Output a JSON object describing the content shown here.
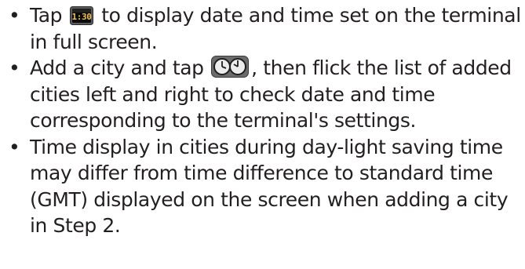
{
  "items": [
    {
      "bullet": "•",
      "before": "Tap ",
      "icon": "clock-display-icon",
      "after": " to display date and time set on the terminal in full screen."
    },
    {
      "bullet": "•",
      "before": "Add a city and tap ",
      "icon": "dual-clock-icon",
      "after": ", then flick the list of added cities left and right to check date and time corresponding to the terminal's settings."
    },
    {
      "bullet": "•",
      "text": "Time display in cities during day-light saving time may differ from time difference to standard time (GMT) displayed on the screen when adding a city in Step 2."
    }
  ],
  "icons": {
    "clock_display_text": "1:30"
  },
  "colors": {
    "text": "#231f20",
    "icon_frame": "#4a4a4a",
    "icon_screen": "#0a0a0a",
    "icon_digits": "#f2c14e"
  }
}
